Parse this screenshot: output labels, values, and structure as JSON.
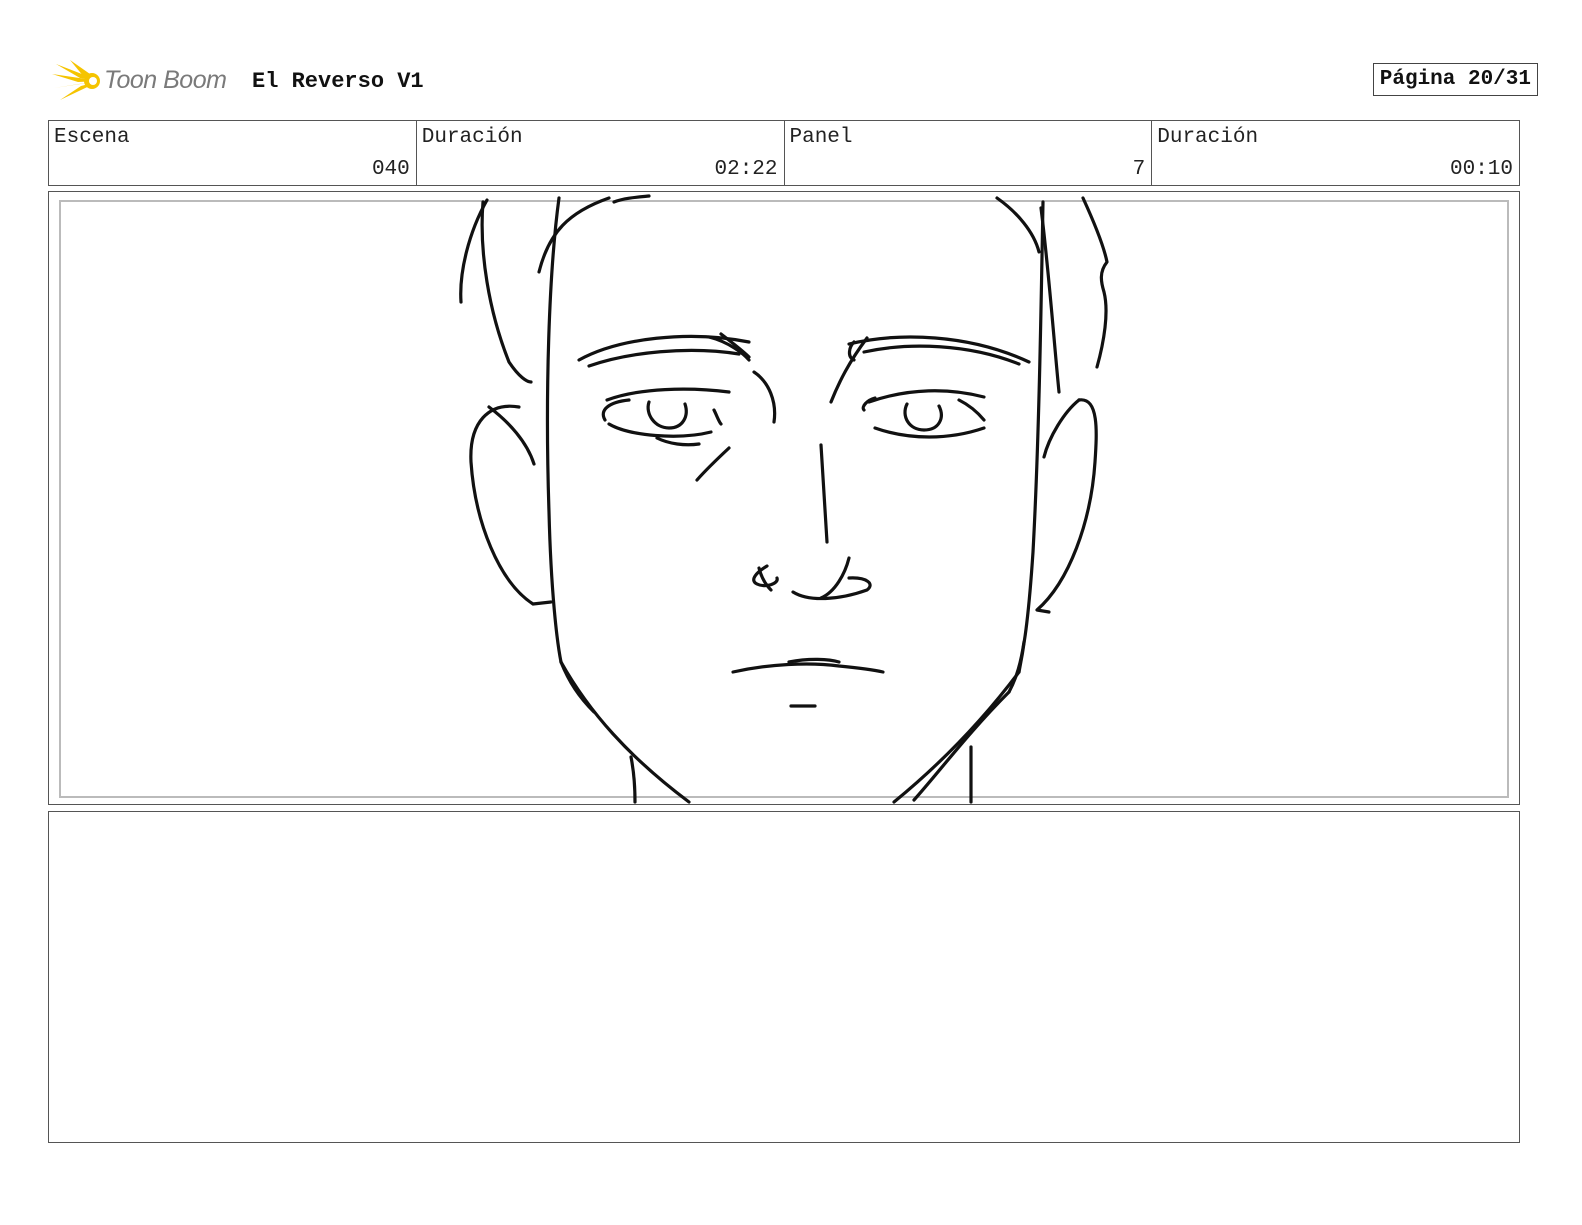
{
  "header": {
    "logo_text": "Toon Boom",
    "project_title": "El Reverso V1",
    "page_label": "Página 20/31"
  },
  "info": {
    "scene_label": "Escena",
    "scene_value": "040",
    "scene_duration_label": "Duración",
    "scene_duration_value": "02:22",
    "panel_label": "Panel",
    "panel_value": "7",
    "panel_duration_label": "Duración",
    "panel_duration_value": "00:10"
  },
  "colors": {
    "logo_yellow": "#f5c400",
    "logo_text": "#7a7a7a",
    "border": "#555555"
  },
  "icons": {
    "logo": "toon-boom-starburst-icon"
  }
}
